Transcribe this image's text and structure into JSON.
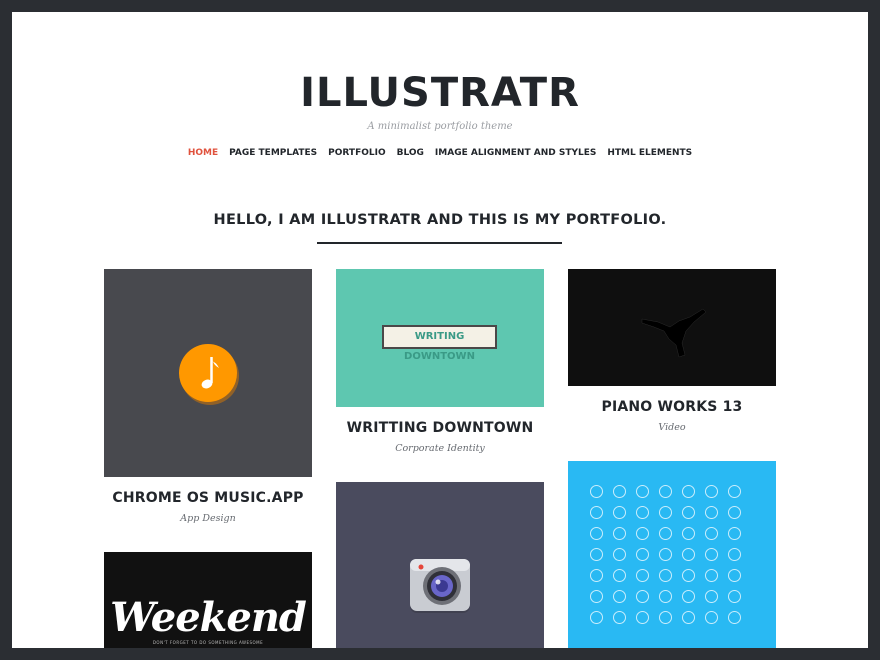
{
  "site": {
    "title": "ILLUSTRATR",
    "tagline": "A minimalist portfolio theme"
  },
  "nav": {
    "items": [
      {
        "label": "HOME",
        "active": true
      },
      {
        "label": "PAGE TEMPLATES"
      },
      {
        "label": "PORTFOLIO"
      },
      {
        "label": "BLOG"
      },
      {
        "label": "IMAGE ALIGNMENT AND STYLES"
      },
      {
        "label": "HTML ELEMENTS"
      }
    ]
  },
  "intro": {
    "heading": "HELLO, I AM ILLUSTRATR AND THIS IS MY PORTFOLIO."
  },
  "portfolio": [
    {
      "title": "CHROME OS MUSIC.APP",
      "category": "App Design",
      "thumb_icon": "music-note-icon",
      "thumb_color": "#48494e"
    },
    {
      "title": "WRITTING DOWNTOWN",
      "category": "Corporate Identity",
      "thumb_text": "WRITING DOWNTOWN",
      "thumb_color": "#5ec7b0"
    },
    {
      "title": "PIANO WORKS 13",
      "category": "Video",
      "thumb_icon": "dancer-silhouette",
      "thumb_color": "#0f0f0f"
    },
    {
      "title": "",
      "category": "",
      "thumb_text": "Weekend",
      "thumb_subtext": "DON'T FORGET TO DO SOMETHING AWESOME",
      "thumb_color": "#111111"
    },
    {
      "title": "",
      "category": "",
      "thumb_icon": "camera-icon",
      "thumb_color": "#4a4b5e"
    },
    {
      "title": "",
      "category": "",
      "thumb_icon": "line-icons-grid",
      "thumb_color": "#29b9f3"
    }
  ],
  "colors": {
    "accent": "#e0523d",
    "text": "#22262b",
    "frame": "#2b2e33",
    "music_app_orange": "#ff9800"
  }
}
